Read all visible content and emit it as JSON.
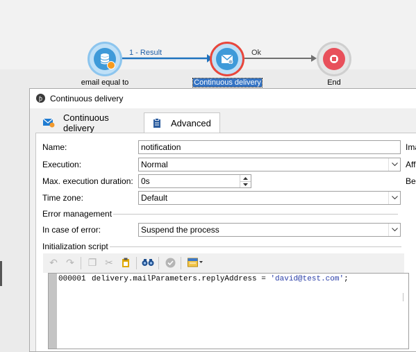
{
  "workflow": {
    "nodes": [
      {
        "label": "email equal to"
      },
      {
        "label": "Continuous delivery"
      },
      {
        "label": "End"
      }
    ],
    "transitions": [
      {
        "label": "1 - Result"
      },
      {
        "label": "Ok"
      }
    ]
  },
  "dialog": {
    "title": "Continuous delivery",
    "tabs": [
      {
        "label": "Continuous delivery",
        "icon": "envelope-gear-icon"
      },
      {
        "label": "Advanced",
        "icon": "clipboard-icon"
      }
    ],
    "fields": {
      "name": {
        "label": "Name:",
        "value": "notification"
      },
      "execution": {
        "label": "Execution:",
        "value": "Normal"
      },
      "max_duration": {
        "label": "Max. execution duration:",
        "value": "0s"
      },
      "timezone": {
        "label": "Time zone:",
        "value": "Default"
      }
    },
    "error_management": {
      "section_title": "Error management",
      "label": "In case of error:",
      "value": "Suspend the process"
    },
    "init_script": {
      "section_title": "Initialization script",
      "line_number": "000001",
      "code_prefix": "delivery.mailParameters.replyAddress = ",
      "code_string": "'david@test.com'",
      "code_suffix": ";"
    },
    "right_column": {
      "item1": "Ima",
      "item2": "Aff",
      "item3": "Beh"
    }
  },
  "colors": {
    "flow_arrow": "#1e73be",
    "node_blue": "#4aa3df",
    "node_selected_border": "#e8473c",
    "selected_label_bg": "#3373c4",
    "code_string": "#2a3ea8"
  }
}
